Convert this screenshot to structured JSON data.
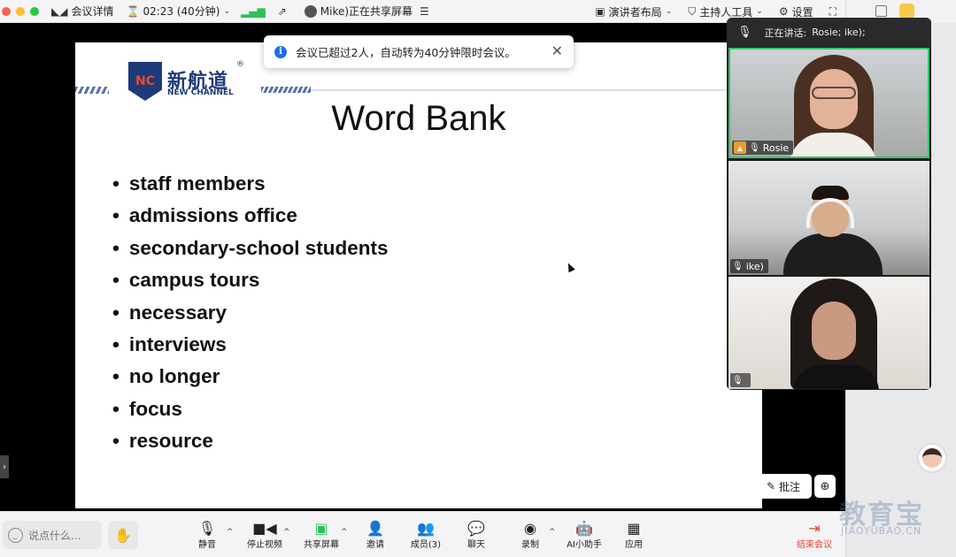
{
  "topbar": {
    "meeting_details": "会议详情",
    "timer": "02:23 (40分钟)",
    "sharing_status": "Mike)正在共享屏幕",
    "speaker_layout": "演讲者布局",
    "host_tools": "主持人工具",
    "settings": "设置"
  },
  "notice": {
    "text": "会议已超过2人，自动转为40分钟限时会议。"
  },
  "slide": {
    "logo_abbr": "NC",
    "logo_cn": "新航道",
    "logo_en": "NEW CHANNEL",
    "logo_reg": "®",
    "title": "Word Bank",
    "words": [
      "staff members",
      "admissions office",
      "secondary-school students",
      "campus tours",
      "necessary",
      "interviews",
      "no longer",
      "focus",
      "resource"
    ]
  },
  "video_panel": {
    "speaking_label": "正在讲话:",
    "speaking_names": "Rosie; ike);",
    "participants": [
      {
        "name": "Rosie"
      },
      {
        "name": "ike)"
      },
      {
        "name": ""
      }
    ]
  },
  "bottombar": {
    "chat_placeholder": "说点什么...",
    "mute": "静音",
    "stop_video": "停止视频",
    "share_screen": "共享屏幕",
    "invite": "邀请",
    "members": "成员(3)",
    "chat": "聊天",
    "record": "录制",
    "ai_assistant": "AI小助手",
    "apps": "应用",
    "end_meeting": "结束会议"
  },
  "overlay": {
    "annotate": "批注"
  },
  "watermark": {
    "cn": "教育宝",
    "en": "JIAOYUBAO.CN"
  },
  "colors": {
    "accent": "#1f6feb",
    "active_speaker_border": "#37c26b",
    "end_meeting": "#e2412e",
    "brand_navy": "#1f3a7a"
  }
}
